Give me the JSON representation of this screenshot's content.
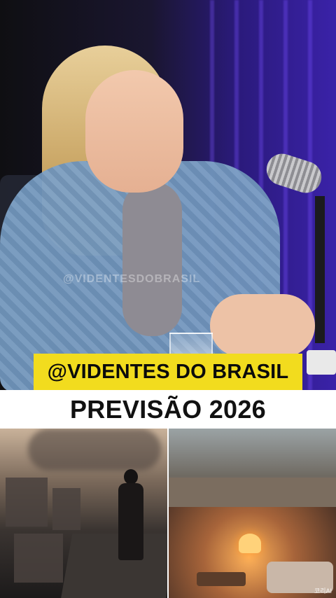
{
  "video": {
    "handle_banner": "@VIDENTES DO BRASIL",
    "watermark": "@VIDENTESDOBRASIL"
  },
  "title": {
    "text": "PREVISÃO 2026"
  },
  "images": {
    "left_icon": "city-ruins-image",
    "right_icon": "underground-shelter-image",
    "right_corner_tag": "코리AI"
  },
  "colors": {
    "banner_yellow": "#f2dc1e",
    "title_text": "#111111"
  }
}
